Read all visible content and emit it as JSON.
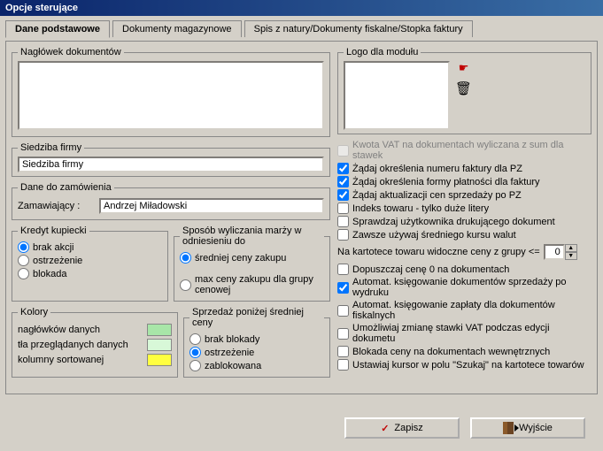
{
  "window_title": "Opcje sterujące",
  "tabs": {
    "t1": "Dane podstawowe",
    "t2": "Dokumenty magazynowe",
    "t3": "Spis z natury/Dokumenty fiskalne/Stopka faktury"
  },
  "left": {
    "header_frame": "Nagłówek dokumentów",
    "header_text": "",
    "siedziba_frame": "Siedziba firmy",
    "siedziba_value": "Siedziba firmy",
    "zamowienia_frame": "Dane do zamówienia",
    "zamawiajacy_label": "Zamawiający :",
    "zamawiajacy_value": "Andrzej Miładowski",
    "kredyt_frame": "Kredyt kupiecki",
    "kredyt_opts": {
      "a": "brak akcji",
      "b": "ostrzeżenie",
      "c": "blokada"
    },
    "marza_frame": "Sposób wyliczania marży w odniesieniu do",
    "marza_opts": {
      "a": "średniej ceny zakupu",
      "b": "max ceny zakupu dla grupy cenowej"
    },
    "kolory_frame": "Kolory",
    "kolor_a": "nagłówków danych",
    "kolor_b": "tła przeglądanych danych",
    "kolor_c": "kolumny sortowanej",
    "swatch_a": "#a8e6a8",
    "swatch_b": "#d8f8d8",
    "swatch_c": "#ffff40",
    "sprzedaz_frame": "Sprzedaż poniżej średniej ceny",
    "sprzedaz_opts": {
      "a": "brak blokady",
      "b": "ostrzeżenie",
      "c": "zablokowana"
    }
  },
  "right": {
    "logo_frame": "Logo dla modułu",
    "vat_label": "Kwota VAT na dokumentach wyliczana z sum dla stawek",
    "chk1": "Żądaj określenia numeru faktury dla PZ",
    "chk2": "Żądaj określenia formy płatności dla faktury",
    "chk3": "Żądaj aktualizacji cen sprzedaży po PZ",
    "chk4": "Indeks towaru - tylko duże litery",
    "chk5": "Sprawdzaj użytkownika drukującego dokument",
    "chk6": "Zawsze używaj średniego kursu walut",
    "kartoteka_label": "Na kartotece towaru widoczne ceny z grupy <=",
    "kartoteka_value": "0",
    "chk7": "Dopuszczaj cenę 0 na dokumentach",
    "chk8": "Automat. księgowanie dokumentów sprzedaży po wydruku",
    "chk9": "Automat. księgowanie zapłaty dla dokumentów fiskalnych",
    "chk10": "Umożliwiaj zmianę stawki VAT podczas edycji dokumetu",
    "chk11": "Blokada ceny na dokumentach wewnętrznych",
    "chk12": "Ustawiaj kursor w polu \"Szukaj\" na kartotece towarów"
  },
  "buttons": {
    "save": "Zapisz",
    "exit": "Wyjście"
  }
}
